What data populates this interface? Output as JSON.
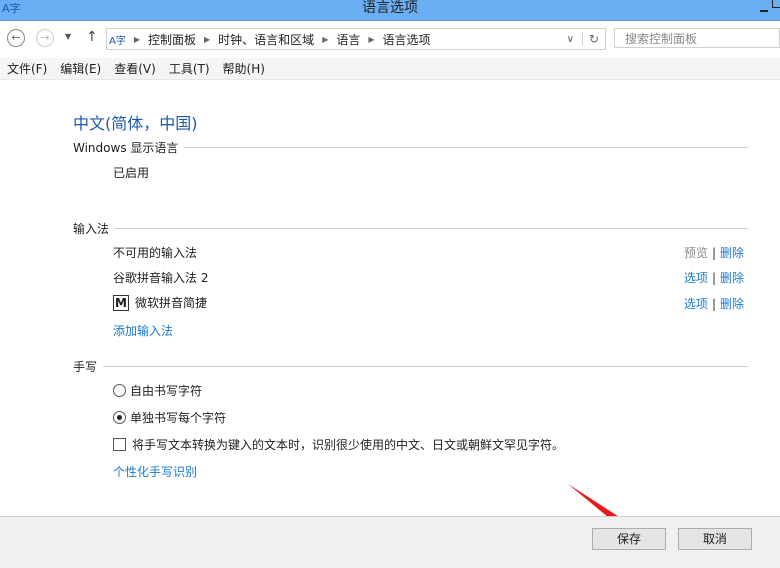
{
  "window": {
    "title": "语言选项"
  },
  "nav": {
    "breadcrumb": [
      "控制面板",
      "时钟、语言和区域",
      "语言",
      "语言选项"
    ],
    "search_placeholder": "搜索控制面板"
  },
  "menu": [
    "文件(F)",
    "编辑(E)",
    "查看(V)",
    "工具(T)",
    "帮助(H)"
  ],
  "main": {
    "title": "中文(简体，中国)",
    "display_section": "Windows 显示语言",
    "display_status": "已启用",
    "input_section": "输入法",
    "input_methods": [
      {
        "name": "不可用的输入法",
        "action1": "预览",
        "action2": "删除"
      },
      {
        "name": "谷歌拼音输入法 2",
        "action1": "选项",
        "action2": "删除"
      },
      {
        "name": "微软拼音简捷",
        "icon": "M",
        "action1": "选项",
        "action2": "删除"
      }
    ],
    "add_input": "添加输入法",
    "handwriting_section": "手写",
    "hw_options": [
      "自由书写字符",
      "单独书写每个字符"
    ],
    "hw_selected": 1,
    "hw_checkbox": "将手写文本转换为键入的文本时，识别很少使用的中文、日文或朝鲜文罕见字符。",
    "personalize": "个性化手写识别"
  },
  "footer": {
    "save": "保存",
    "cancel": "取消"
  }
}
